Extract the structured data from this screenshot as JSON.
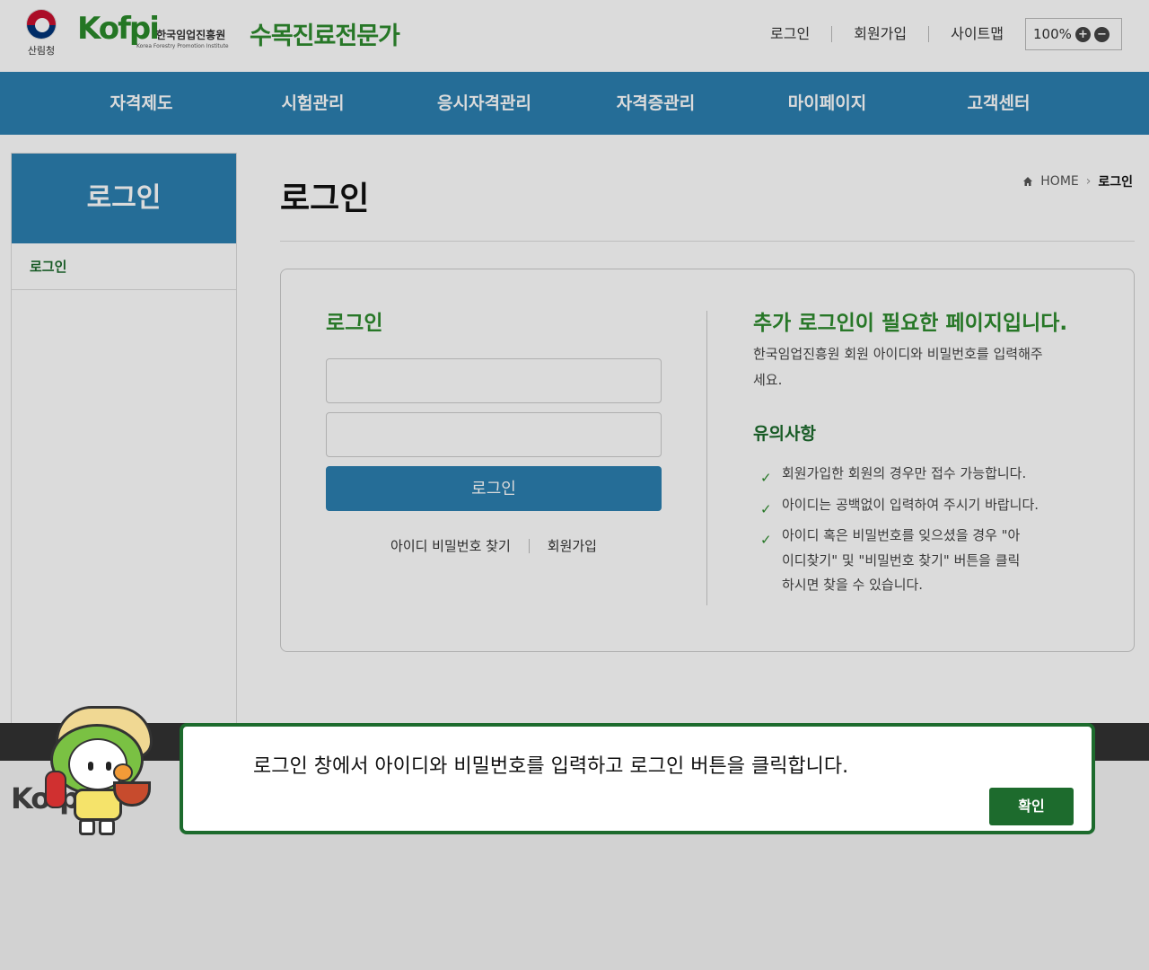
{
  "header": {
    "gov_label": "산림청",
    "logo_text": "Kofpi",
    "logo_org_kr": "한국임업진흥원",
    "logo_org_en": "Korea Forestry Promotion Institute",
    "site_title": "수목진료전문가",
    "util_links": [
      "로그인",
      "회원가입",
      "사이트맵"
    ],
    "zoom": "100%"
  },
  "nav": {
    "items": [
      "자격제도",
      "시험관리",
      "응시자격관리",
      "자격증관리",
      "마이페이지",
      "고객센터"
    ]
  },
  "sidebar": {
    "title": "로그인",
    "items": [
      "로그인"
    ]
  },
  "page": {
    "title": "로그인",
    "breadcrumb": [
      "HOME",
      "로그인"
    ]
  },
  "login": {
    "title": "로그인",
    "id_value": "",
    "pw_value": "",
    "button": "로그인",
    "links": [
      "아이디 비밀번호 찾기",
      "회원가입"
    ]
  },
  "info": {
    "title": "추가 로그인이 필요한 페이지입니다.",
    "desc": "한국임업진흥원 회원 아이디와 비밀번호를 입력해주세요.",
    "notice_title": "유의사항",
    "notices": [
      "회원가입한 회원의 경우만 접수 가능합니다.",
      "아이디는 공백없이 입력하여 주시기 바랍니다.",
      "아이디 혹은 비밀번호를 잊으셨을 경우 \"아이디찾기\" 및 \"비밀번호 찾기\" 버튼을 클릭하시면 찾을 수 있습니다."
    ]
  },
  "footer": {
    "logo_text": "Kofpi"
  },
  "dialog": {
    "message": "로그인 창에서 아이디와 비밀번호를 입력하고 로그인 버튼을 클릭합니다.",
    "confirm": "확인"
  },
  "colors": {
    "primary_blue": "#2c7fb0",
    "brand_green": "#2e8b2e",
    "dark_green": "#1d6b2d"
  }
}
